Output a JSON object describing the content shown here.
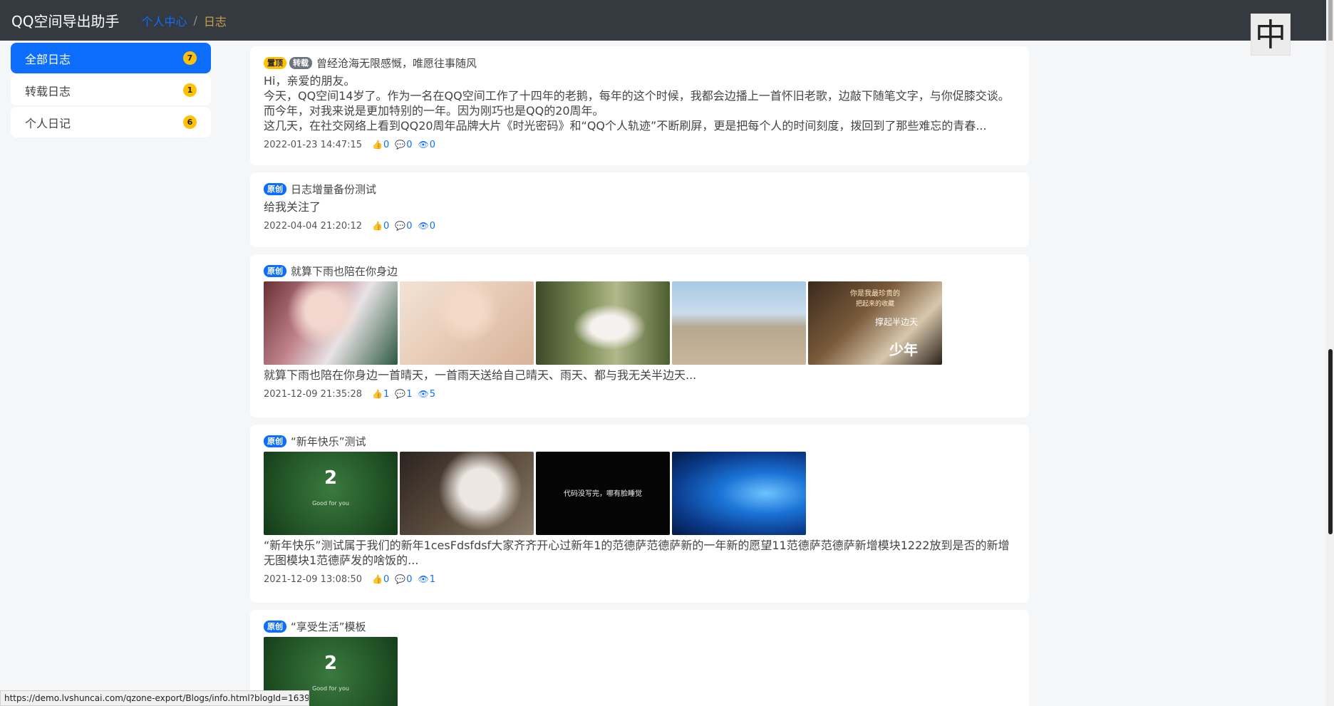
{
  "header": {
    "brand": "QQ空间导出助手",
    "breadcrumb": {
      "home": "个人中心",
      "separator": "/",
      "current": "日志"
    },
    "lang_button": "中"
  },
  "sidebar": {
    "items": [
      {
        "label": "全部日志",
        "count": "7",
        "active": true
      },
      {
        "label": "转载日志",
        "count": "1",
        "active": false
      },
      {
        "label": "个人日记",
        "count": "6",
        "active": false
      }
    ]
  },
  "posts": [
    {
      "tags": [
        "置顶",
        "转载"
      ],
      "title": "曾经沧海无限感慨，唯愿往事随风",
      "summary_lines": [
        "Hi，亲爱的朋友。",
        "今天，QQ空间14岁了。作为一名在QQ空间工作了十四年的老鹅，每年的这个时候，我都会边播上一首怀旧老歌，边敲下随笔文字，与你促膝交谈。",
        "而今年，对我来说是更加特别的一年。因为刚巧也是QQ的20周年。",
        "这几天，在社交网络上看到QQ20周年品牌大片《时光密码》和“QQ个人轨迹”不断刷屏，更是把每个人的时间刻度，拨回到了那些难忘的青春..."
      ],
      "date": "2022-01-23 14:47:15",
      "likes": "0",
      "comments": "0",
      "views": "0"
    },
    {
      "tags": [
        "原创"
      ],
      "title": "日志增量备份测试",
      "summary_lines": [
        "给我关注了"
      ],
      "date": "2022-04-04 21:20:12",
      "likes": "0",
      "comments": "0",
      "views": "0"
    },
    {
      "tags": [
        "原创"
      ],
      "title": "就算下雨也陪在你身边",
      "summary_lines": [
        "就算下雨也陪在你身边一首晴天，一首雨天送给自己晴天、雨天、都与我无关半边天..."
      ],
      "date": "2021-12-09 21:35:28",
      "likes": "1",
      "comments": "1",
      "views": "5",
      "image_overlay_text": [
        "你是我最珍贵的",
        "把起来的收藏",
        "撑起半边天",
        "少年"
      ]
    },
    {
      "tags": [
        "原创"
      ],
      "title": "“新年快乐”测试",
      "summary_lines": [
        "“新年快乐”测试属于我们的新年1cesFdsfdsf大家齐齐开心过新年1的范德萨范德萨新的一年新的愿望11范德萨范德萨新增模块1222放到是否的新增",
        "无图模块1范德萨发的啥饭的..."
      ],
      "date": "2021-12-09 13:08:50",
      "likes": "0",
      "comments": "0",
      "views": "1",
      "image_overlay_text": [
        "2",
        "Good for you",
        "代码没写完，哪有脸睡觉"
      ]
    },
    {
      "tags": [
        "原创"
      ],
      "title": "“享受生活”模板",
      "image_overlay_text": [
        "2",
        "Good for you"
      ]
    }
  ],
  "status_url": "https://demo.lvshuncai.com/qzone-export/Blogs/info.html?blogId=1639056928",
  "colors": {
    "primary": "#0d6efd",
    "warning": "#ffc107",
    "secondary": "#6c757d",
    "header_bg": "#343a40"
  }
}
